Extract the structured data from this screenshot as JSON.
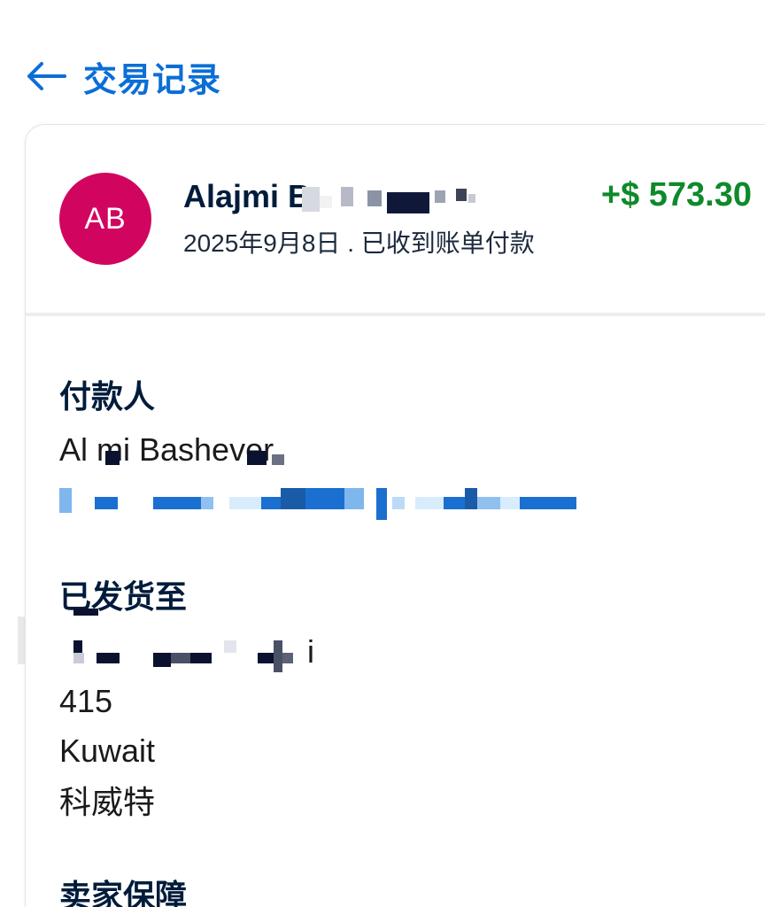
{
  "header": {
    "back_icon": "arrow-left-icon",
    "title": "交易记录"
  },
  "colors": {
    "accent": "#0b6ed6",
    "avatar": "#d1055f",
    "positive_amount": "#0e8a2a",
    "text_primary": "#001c3b"
  },
  "transaction": {
    "avatar_initials": "AB",
    "payer_name_visible": "Alajmi B",
    "amount": "+$ 573.30",
    "meta": "2025年9月8日 . 已收到账单付款"
  },
  "payer_section": {
    "title": "付款人",
    "name_visible": "Al  mi Bashever"
  },
  "shipping_section": {
    "title": "已发货至",
    "address_line_suffix": "i",
    "postal": "415",
    "country_en": "Kuwait",
    "country_zh": "科威特"
  },
  "seller_section": {
    "title": "卖家保障"
  }
}
